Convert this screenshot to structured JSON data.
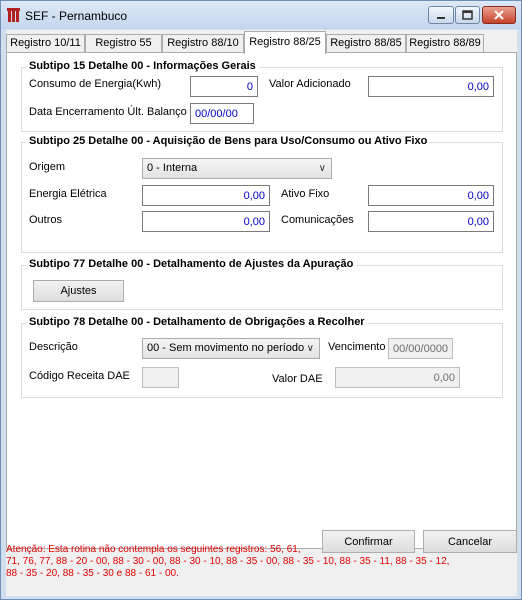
{
  "window": {
    "title": "SEF - Pernambuco",
    "icon": "sef-app-icon",
    "controls": [
      "minimize-icon",
      "maximize-icon",
      "close-icon"
    ]
  },
  "tabs": [
    "Registro 10/11",
    "Registro 55",
    "Registro 88/10",
    "Registro 88/25",
    "Registro 88/85",
    "Registro 88/89"
  ],
  "active_tab": "Registro 88/25",
  "sub15": {
    "title": "Subtipo 15 Detalhe 00 - Informações Gerais",
    "consumo_label": "Consumo de Energia(Kwh)",
    "consumo_value": "0",
    "valor_adicionado_label": "Valor Adicionado",
    "valor_adicionado_value": "0,00",
    "data_encerramento_label": "Data Encerramento Últ. Balanço",
    "data_encerramento_value": "00/00/00"
  },
  "sub25": {
    "title": "Subtipo 25 Detalhe 00 - Aquisição de Bens para Uso/Consumo ou Ativo Fixo",
    "origem_label": "Origem",
    "origem_value": "0 - Interna",
    "energia_label": "Energia Elétrica",
    "energia_value": "0,00",
    "ativo_label": "Ativo Fixo",
    "ativo_value": "0,00",
    "outros_label": "Outros",
    "outros_value": "0,00",
    "comunicacoes_label": "Comunicações",
    "comunicacoes_value": "0,00"
  },
  "sub77": {
    "title": "Subtipo 77 Detalhe 00 - Detalhamento de Ajustes da Apuração",
    "ajustes_button": "Ajustes"
  },
  "sub78": {
    "title": "Subtipo 78 Detalhe 00 - Detalhamento de Obrigações a Recolher",
    "descricao_label": "Descrição",
    "descricao_value": "00 - Sem movimento no período",
    "vencimento_label": "Vencimento",
    "vencimento_value": "00/00/0000",
    "codigo_label": "Código Receita DAE",
    "codigo_value": "",
    "valor_dae_label": "Valor DAE",
    "valor_dae_value": "0,00"
  },
  "buttons": {
    "confirmar": "Confirmar",
    "cancelar": "Cancelar"
  },
  "warning": "Atenção: Esta rotina não contempla os seguintes registros: 56, 61,\n71, 76, 77, 88 - 20 - 00, 88 - 30 - 00, 88 - 30 - 10, 88 - 35 - 00, 88 - 35 - 10, 88 - 35 - 11, 88 - 35 - 12,\n88 - 35 - 20, 88 - 35 - 30 e 88 - 61 - 00.",
  "colors": {
    "warning_text": "#e00000",
    "field_value": "#0000cc",
    "title_bar": "#c3d6ee",
    "close_button": "#c7422a"
  }
}
